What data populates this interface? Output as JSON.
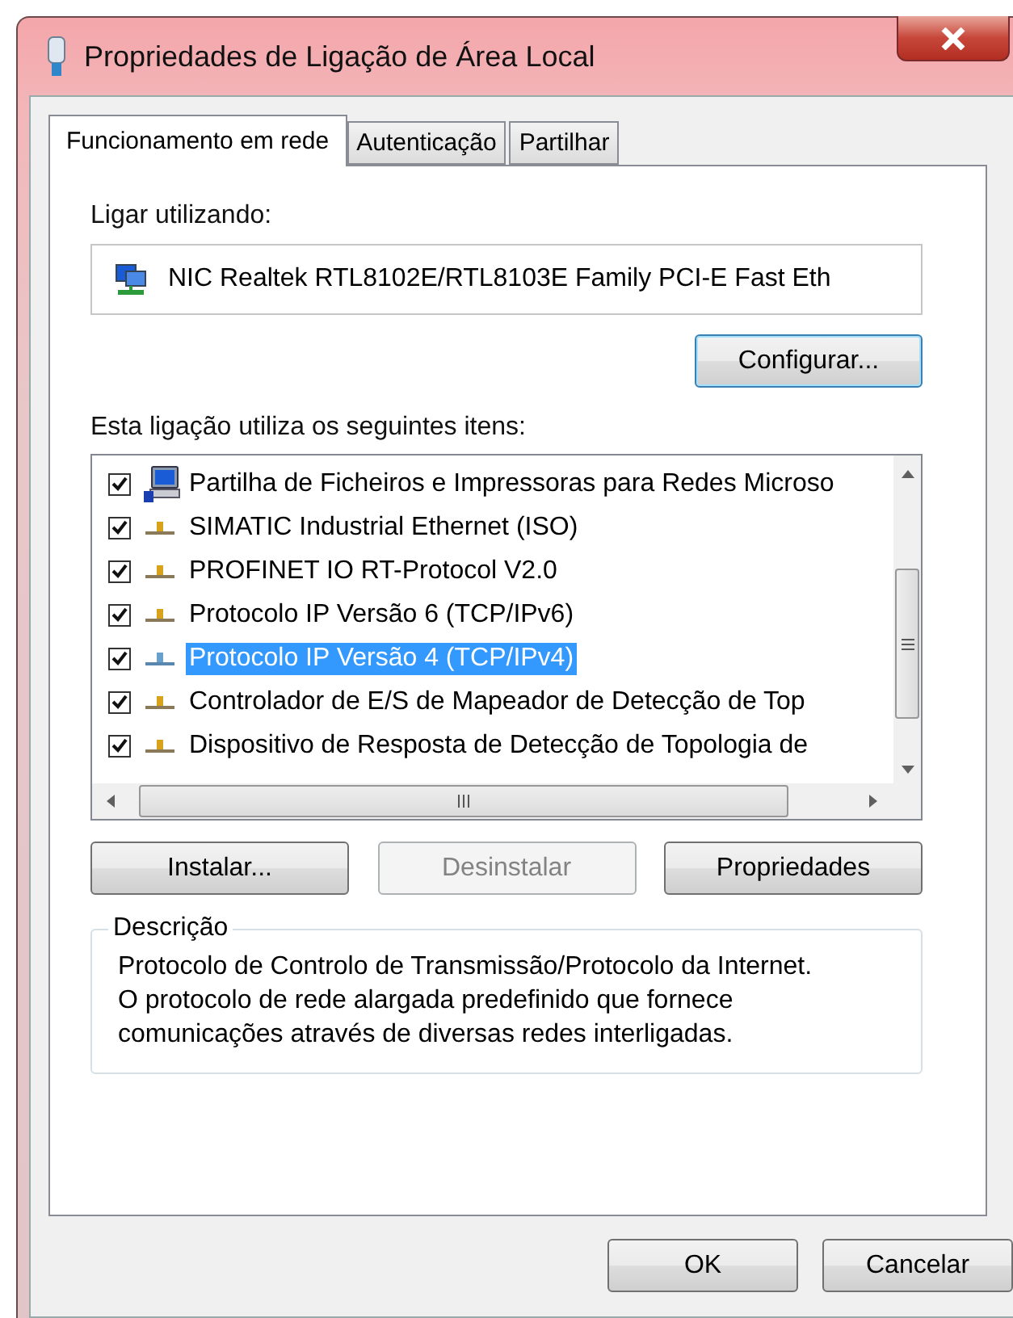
{
  "window": {
    "title": "Propriedades de Ligação de Área Local"
  },
  "tabs": [
    {
      "label": "Funcionamento em rede",
      "selected": true
    },
    {
      "label": "Autenticação",
      "selected": false
    },
    {
      "label": "Partilhar",
      "selected": false
    }
  ],
  "connect_using": {
    "label": "Ligar utilizando:",
    "adapter": "NIC Realtek RTL8102E/RTL8103E Family PCI-E Fast Eth",
    "configure_button": "Configurar..."
  },
  "items_label": "Esta ligação utiliza os seguintes itens:",
  "items": [
    {
      "kind": "computer",
      "label": "Partilha de Ficheiros e Impressoras para Redes Microso",
      "checked": true,
      "selected": false
    },
    {
      "kind": "protocol",
      "label": "SIMATIC Industrial Ethernet (ISO)",
      "checked": true,
      "selected": false
    },
    {
      "kind": "protocol",
      "label": "PROFINET IO RT-Protocol V2.0",
      "checked": true,
      "selected": false
    },
    {
      "kind": "protocol",
      "label": "Protocolo IP Versão 6 (TCP/IPv6)",
      "checked": true,
      "selected": false
    },
    {
      "kind": "protocol",
      "label": "Protocolo IP Versão 4 (TCP/IPv4)",
      "checked": true,
      "selected": true
    },
    {
      "kind": "protocol",
      "label": "Controlador de E/S de Mapeador de Detecção de Top",
      "checked": true,
      "selected": false
    },
    {
      "kind": "protocol",
      "label": "Dispositivo de Resposta de Detecção de Topologia de",
      "checked": true,
      "selected": false
    }
  ],
  "item_buttons": [
    {
      "label": "Instalar...",
      "disabled": false
    },
    {
      "label": "Desinstalar",
      "disabled": true
    },
    {
      "label": "Propriedades",
      "disabled": false
    }
  ],
  "description": {
    "legend": "Descrição",
    "text": "Protocolo de Controlo de Transmissão/Protocolo da Internet.\nO protocolo de rede alargada predefinido que fornece\ncomunicações através de diversas redes interligadas."
  },
  "footer_buttons": [
    "OK",
    "Cancelar"
  ]
}
